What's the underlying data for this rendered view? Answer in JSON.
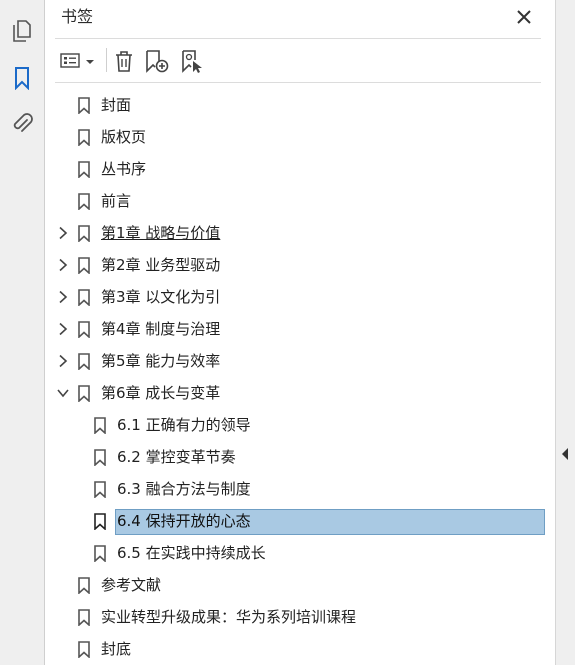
{
  "left_rail": {
    "items": [
      {
        "icon": "pages-icon",
        "active": false
      },
      {
        "icon": "bookmark-icon",
        "active": true
      },
      {
        "icon": "attachment-icon",
        "active": false
      }
    ]
  },
  "bookmarks_panel": {
    "title": "书签",
    "toolbar": {
      "options_icon": "list-options-icon",
      "delete_icon": "trash-icon",
      "new_bookmark_icon": "new-bookmark-icon",
      "new_from_structure_icon": "bookmark-cursor-icon"
    },
    "items": [
      {
        "label": "封面",
        "level": 0,
        "expander": "none"
      },
      {
        "label": "版权页",
        "level": 0,
        "expander": "none"
      },
      {
        "label": "丛书序",
        "level": 0,
        "expander": "none"
      },
      {
        "label": "前言",
        "level": 0,
        "expander": "none"
      },
      {
        "label": "第1章 战略与价值",
        "level": 0,
        "expander": "collapsed",
        "underlined": true
      },
      {
        "label": "第2章 业务型驱动",
        "level": 0,
        "expander": "collapsed"
      },
      {
        "label": "第3章 以文化为引",
        "level": 0,
        "expander": "collapsed"
      },
      {
        "label": "第4章 制度与治理",
        "level": 0,
        "expander": "collapsed"
      },
      {
        "label": "第5章 能力与效率",
        "level": 0,
        "expander": "collapsed"
      },
      {
        "label": "第6章 成长与变革",
        "level": 0,
        "expander": "expanded"
      },
      {
        "label": "6.1 正确有力的领导",
        "level": 1,
        "expander": "none"
      },
      {
        "label": "6.2 掌控变革节奏",
        "level": 1,
        "expander": "none"
      },
      {
        "label": "6.3 融合方法与制度",
        "level": 1,
        "expander": "none"
      },
      {
        "label": "6.4 保持开放的心态",
        "level": 1,
        "expander": "none",
        "selected": true
      },
      {
        "label": "6.5 在实践中持续成长",
        "level": 1,
        "expander": "none"
      },
      {
        "label": "参考文献",
        "level": 0,
        "expander": "none"
      },
      {
        "label": "实业转型升级成果：华为系列培训课程",
        "level": 0,
        "expander": "none"
      },
      {
        "label": "封底",
        "level": 0,
        "expander": "none"
      }
    ]
  },
  "colors": {
    "accent": "#1b6ac9",
    "selection_fill": "#a9c9e3",
    "selection_border": "#6f9ec4"
  }
}
